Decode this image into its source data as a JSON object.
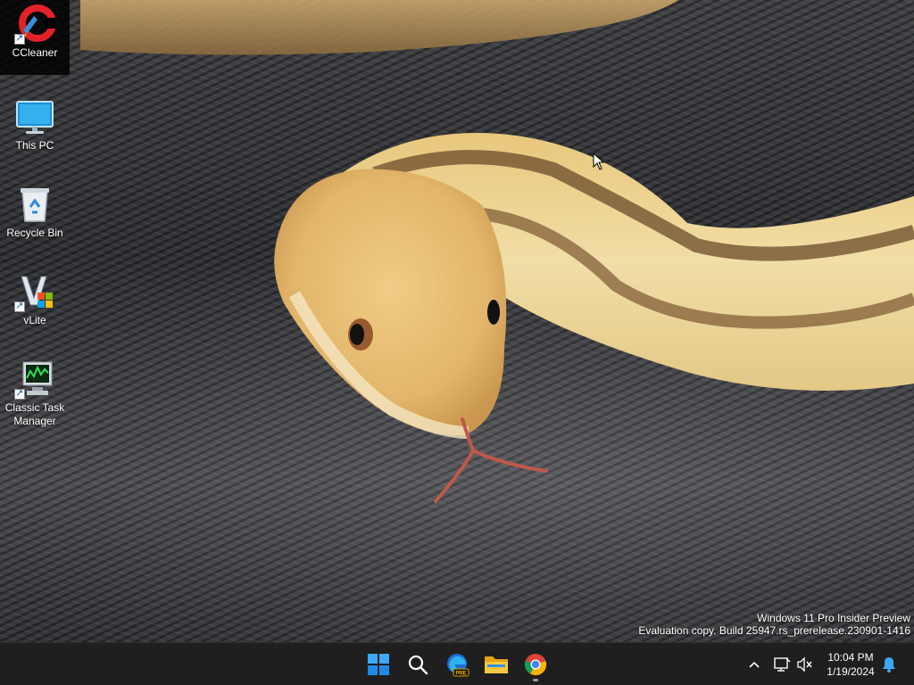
{
  "desktop_icons": [
    {
      "label": "CCleaner",
      "icon": "ccleaner-icon",
      "selected": true
    },
    {
      "label": "This PC",
      "icon": "monitor-icon"
    },
    {
      "label": "Recycle Bin",
      "icon": "recycle-bin-icon"
    },
    {
      "label": "vLite",
      "icon": "vlite-icon"
    },
    {
      "label": "Classic Task Manager",
      "icon": "task-manager-icon"
    }
  ],
  "watermark": {
    "line1": "Windows 11 Pro Insider Preview",
    "line2": "Evaluation copy. Build 25947.rs_prerelease.230901-1416"
  },
  "taskbar": {
    "apps": [
      {
        "name": "Start",
        "icon": "windows-logo-icon"
      },
      {
        "name": "Search",
        "icon": "search-icon"
      },
      {
        "name": "Microsoft Edge Preview",
        "icon": "edge-pre-icon",
        "badge": "PRE"
      },
      {
        "name": "File Explorer",
        "icon": "folder-icon"
      },
      {
        "name": "Google Chrome",
        "icon": "chrome-icon",
        "running": true
      }
    ],
    "tray": {
      "overflow_icon": "chevron-up-icon",
      "network_icon": "network-icon",
      "volume_icon": "volume-muted-icon",
      "notification_icon": "bell-icon"
    },
    "clock": {
      "time": "10:04 PM",
      "date": "1/19/2024"
    }
  },
  "colors": {
    "taskbar_bg": "#1f1f1f",
    "accent": "#0078d4",
    "snake_body": "#e9cf8f",
    "snake_stripe": "#6b4a2a"
  }
}
